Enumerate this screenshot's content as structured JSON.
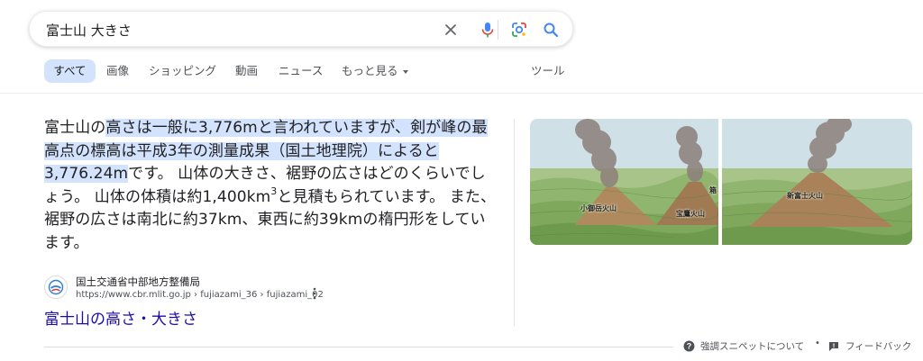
{
  "search": {
    "query": "富士山 大きさ"
  },
  "tabs": [
    {
      "label": "すべて",
      "active": true
    },
    {
      "label": "画像"
    },
    {
      "label": "ショッピング"
    },
    {
      "label": "動画"
    },
    {
      "label": "ニュース"
    },
    {
      "label": "もっと見る"
    }
  ],
  "tools_label": "ツール",
  "snippet": {
    "hl_1": "富士山の",
    "hl_2": "高さは一般に3,776mと言われていますが、剣が峰の最高点の標高は平成3年の測量成果（国土地理院）によると3,776.24m",
    "plain_1": "です。 山体の大きさ、裾野の広さはどのくらいでしょう。 山体の体積は約1,400km",
    "sup": "3",
    "plain_2": "と見積もられています。 また、裾野の広さは南北に約37km、東西に約39kmの楕円形をしています。"
  },
  "images": {
    "left_labels": [
      "小御岳火山",
      "宝鷹火山",
      "箱"
    ],
    "right_labels": [
      "新富士火山"
    ]
  },
  "source": {
    "name": "国土交通省中部地方整備局",
    "url": "https://www.cbr.mlit.go.jp › fujiazami_36 › fujiazami_02"
  },
  "result_title": "富士山の高さ・大きさ",
  "footer": {
    "about": "強調スニペットについて",
    "separator": "•",
    "feedback": "フィードバック"
  },
  "colors": {
    "highlight": "#d3e3fd",
    "link": "#1a0dab",
    "active_tab": "#d3e3fd"
  }
}
